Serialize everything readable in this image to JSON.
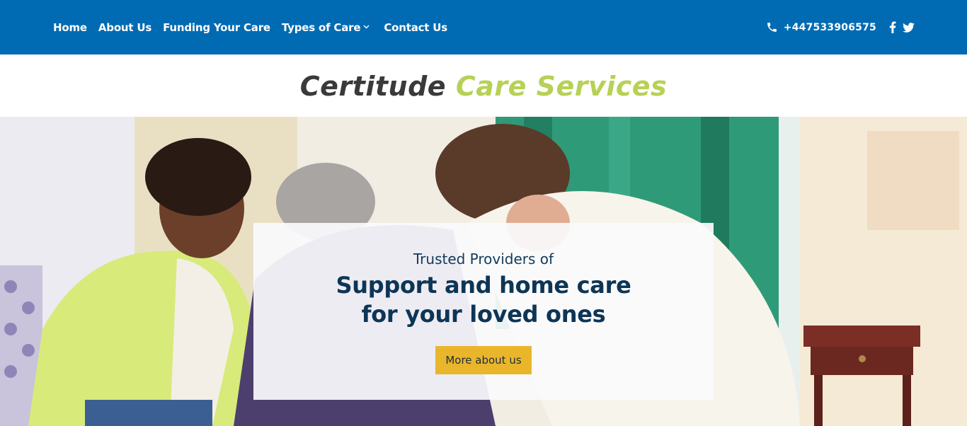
{
  "nav": {
    "items": [
      {
        "label": "Home"
      },
      {
        "label": "About Us"
      },
      {
        "label": "Funding Your Care"
      },
      {
        "label": "Types of Care",
        "has_dropdown": true
      },
      {
        "label": "Contact Us"
      }
    ]
  },
  "contact": {
    "phone": "+447533906575",
    "icons": [
      "phone-icon",
      "facebook-icon",
      "twitter-icon"
    ]
  },
  "logo": {
    "part1": "Certitude",
    "part2": "Care Services"
  },
  "hero": {
    "eyebrow": "Trusted Providers of",
    "title_line1": "Support and home care",
    "title_line2": "for your loved ones",
    "button_label": "More about us"
  },
  "colors": {
    "topbar": "#006bb3",
    "logo_dark": "#3a3a3a",
    "logo_green": "#b7d156",
    "title": "#0d3556",
    "button": "#e9b62b"
  }
}
